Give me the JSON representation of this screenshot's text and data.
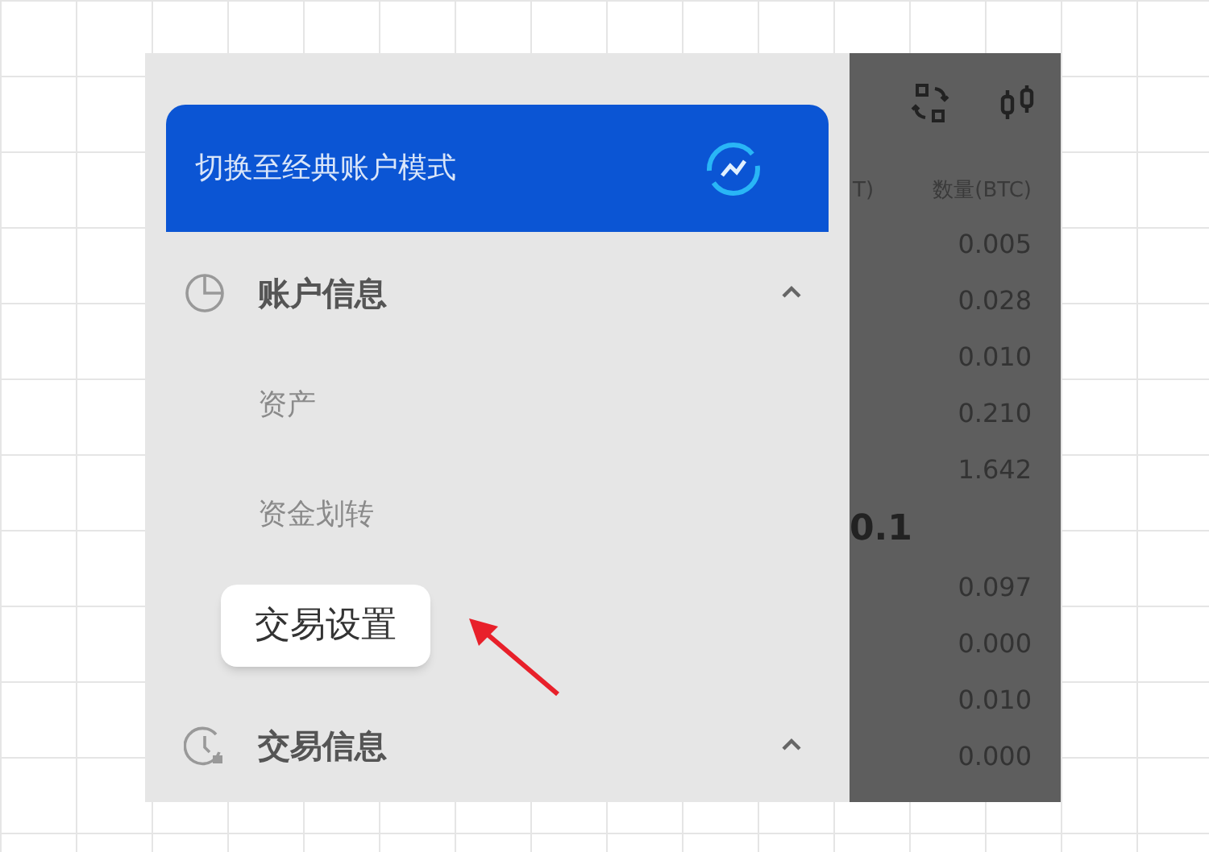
{
  "banner": {
    "label": "切换至经典账户模式"
  },
  "sections": [
    {
      "kind": "chart",
      "title": "账户信息",
      "expanded": true,
      "items": [
        {
          "label": "资产",
          "highlighted": false
        },
        {
          "label": "资金划转",
          "highlighted": false
        },
        {
          "label": "交易设置",
          "highlighted": true
        }
      ]
    },
    {
      "kind": "clock",
      "title": "交易信息",
      "expanded": true
    }
  ],
  "order_book": {
    "column_1": "T)",
    "column_2": "数量(BTC)",
    "asks": [
      "0.005",
      "0.028",
      "0.010",
      "0.210",
      "1.642"
    ],
    "price": "0.1",
    "bids": [
      "0.097",
      "0.000",
      "0.010",
      "0.000"
    ]
  }
}
